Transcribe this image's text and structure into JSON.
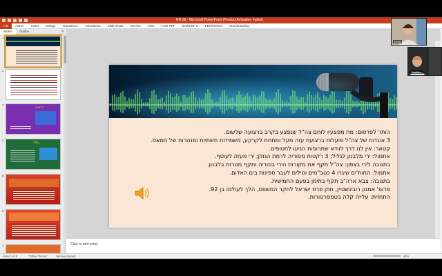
{
  "window": {
    "title": "RR-38 - Microsoft PowerPoint (Product Activation Failed)"
  },
  "ribbon": {
    "tabs": [
      "File",
      "Home",
      "Insert",
      "Design",
      "Transitions",
      "Animations",
      "Slide Show",
      "Review",
      "View",
      "Foxit PDF",
      "deskPDF 8",
      "PDFelement",
      "Storyboarding"
    ]
  },
  "pane": {
    "tabs": [
      "Slides",
      "Outline"
    ],
    "thumbnails": [
      {
        "num": "1",
        "title": ""
      },
      {
        "num": "2",
        "title": ""
      },
      {
        "num": "3",
        "title": "ברזאיה"
      },
      {
        "num": "4",
        "title": "גולדה"
      },
      {
        "num": "5",
        "title": ""
      },
      {
        "num": "6",
        "title": ""
      },
      {
        "num": "7",
        "title": ""
      }
    ]
  },
  "slide": {
    "lines": [
      "הותר לפרסום: מת מפצעיו לוחם צה\"ל שנפצע בקרב ברצועה שלשום.",
      "3 אוגדות של צה\"ל פועלות ברצועת עזה מעל ומתחת לקרקע, משמידות תשתיות ומנהרות של חמאס.",
      "קטאר: אין לנו דרך לוודא שתרופות הגיעו לחטופים.",
      "אתמול: ירי מלבנון לגליל; 3 רקטות מסוריה לרמת הגולן; ירי מעזה לעוטף.",
      "בתגובה לירי בצפון: צה\"ל תקף את מקורות הירי בסוריה ותקף מטרות בלבנון.",
      "אתמול: החות'ים שיגרו 4 כטב\"מים וטילים לעבר ספינות בים האדום.",
      "בתגובה: צבא ארה\"ב תקף בתימן בפעם החמישית.",
      "פרופ' אמנון רובינשטיין, חתן פרס ישראל לחקר המשפט, הלך לעולמו בן 92.",
      "התחזית: עלייה קלה בטמפרטורות."
    ]
  },
  "notes": {
    "placeholder": "Click to add notes"
  },
  "status": {
    "slide": "Slide 1 of 8",
    "theme": "\"Office Theme\"",
    "language": "Hebrew (Israel)",
    "zoom": "63%"
  },
  "participants": [
    {
      "name": "Orna"
    },
    {
      "name": "Hanna z"
    }
  ],
  "colors": {
    "accent": "#c43e1c",
    "banner": "#05253f",
    "slide_bg": "#f9e6d4"
  }
}
